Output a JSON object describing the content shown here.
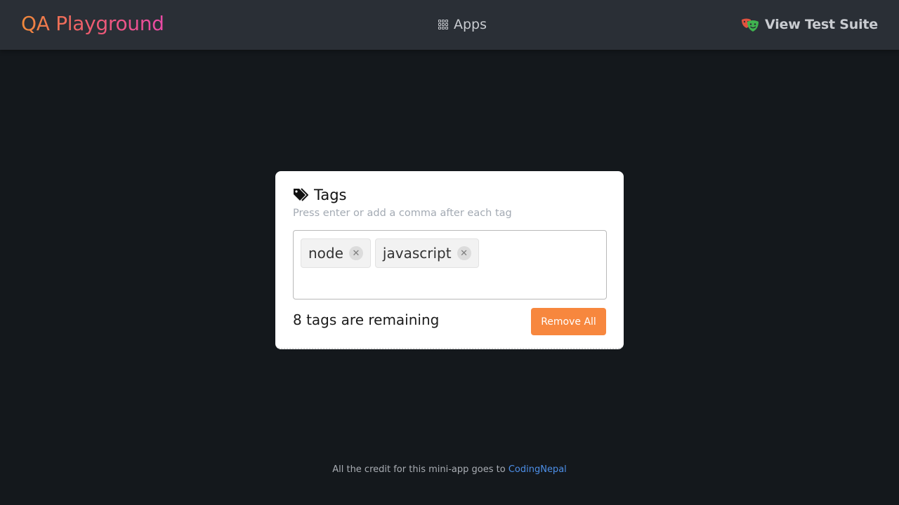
{
  "navbar": {
    "brand": "QA Playground",
    "apps_label": "Apps",
    "apps_icon": "grid-icon",
    "suite_label": "View Test Suite",
    "suite_icon": "theater-masks-icon"
  },
  "card": {
    "title": "Tags",
    "title_icon": "tags-icon",
    "hint": "Press enter or add a comma after each tag",
    "tags": [
      {
        "label": "node",
        "remove_icon": "close-icon"
      },
      {
        "label": "javascript",
        "remove_icon": "close-icon"
      }
    ],
    "input_value": "",
    "remaining_text": "8 tags are remaining",
    "remove_all_label": "Remove All"
  },
  "footer": {
    "credit_text": "All the credit for this mini-app goes to",
    "credit_link": "CodingNepal"
  },
  "colors": {
    "background": "#14181c",
    "navbar": "#2a2f36",
    "accent_button": "#f7873e",
    "link": "#4d8fe8"
  }
}
